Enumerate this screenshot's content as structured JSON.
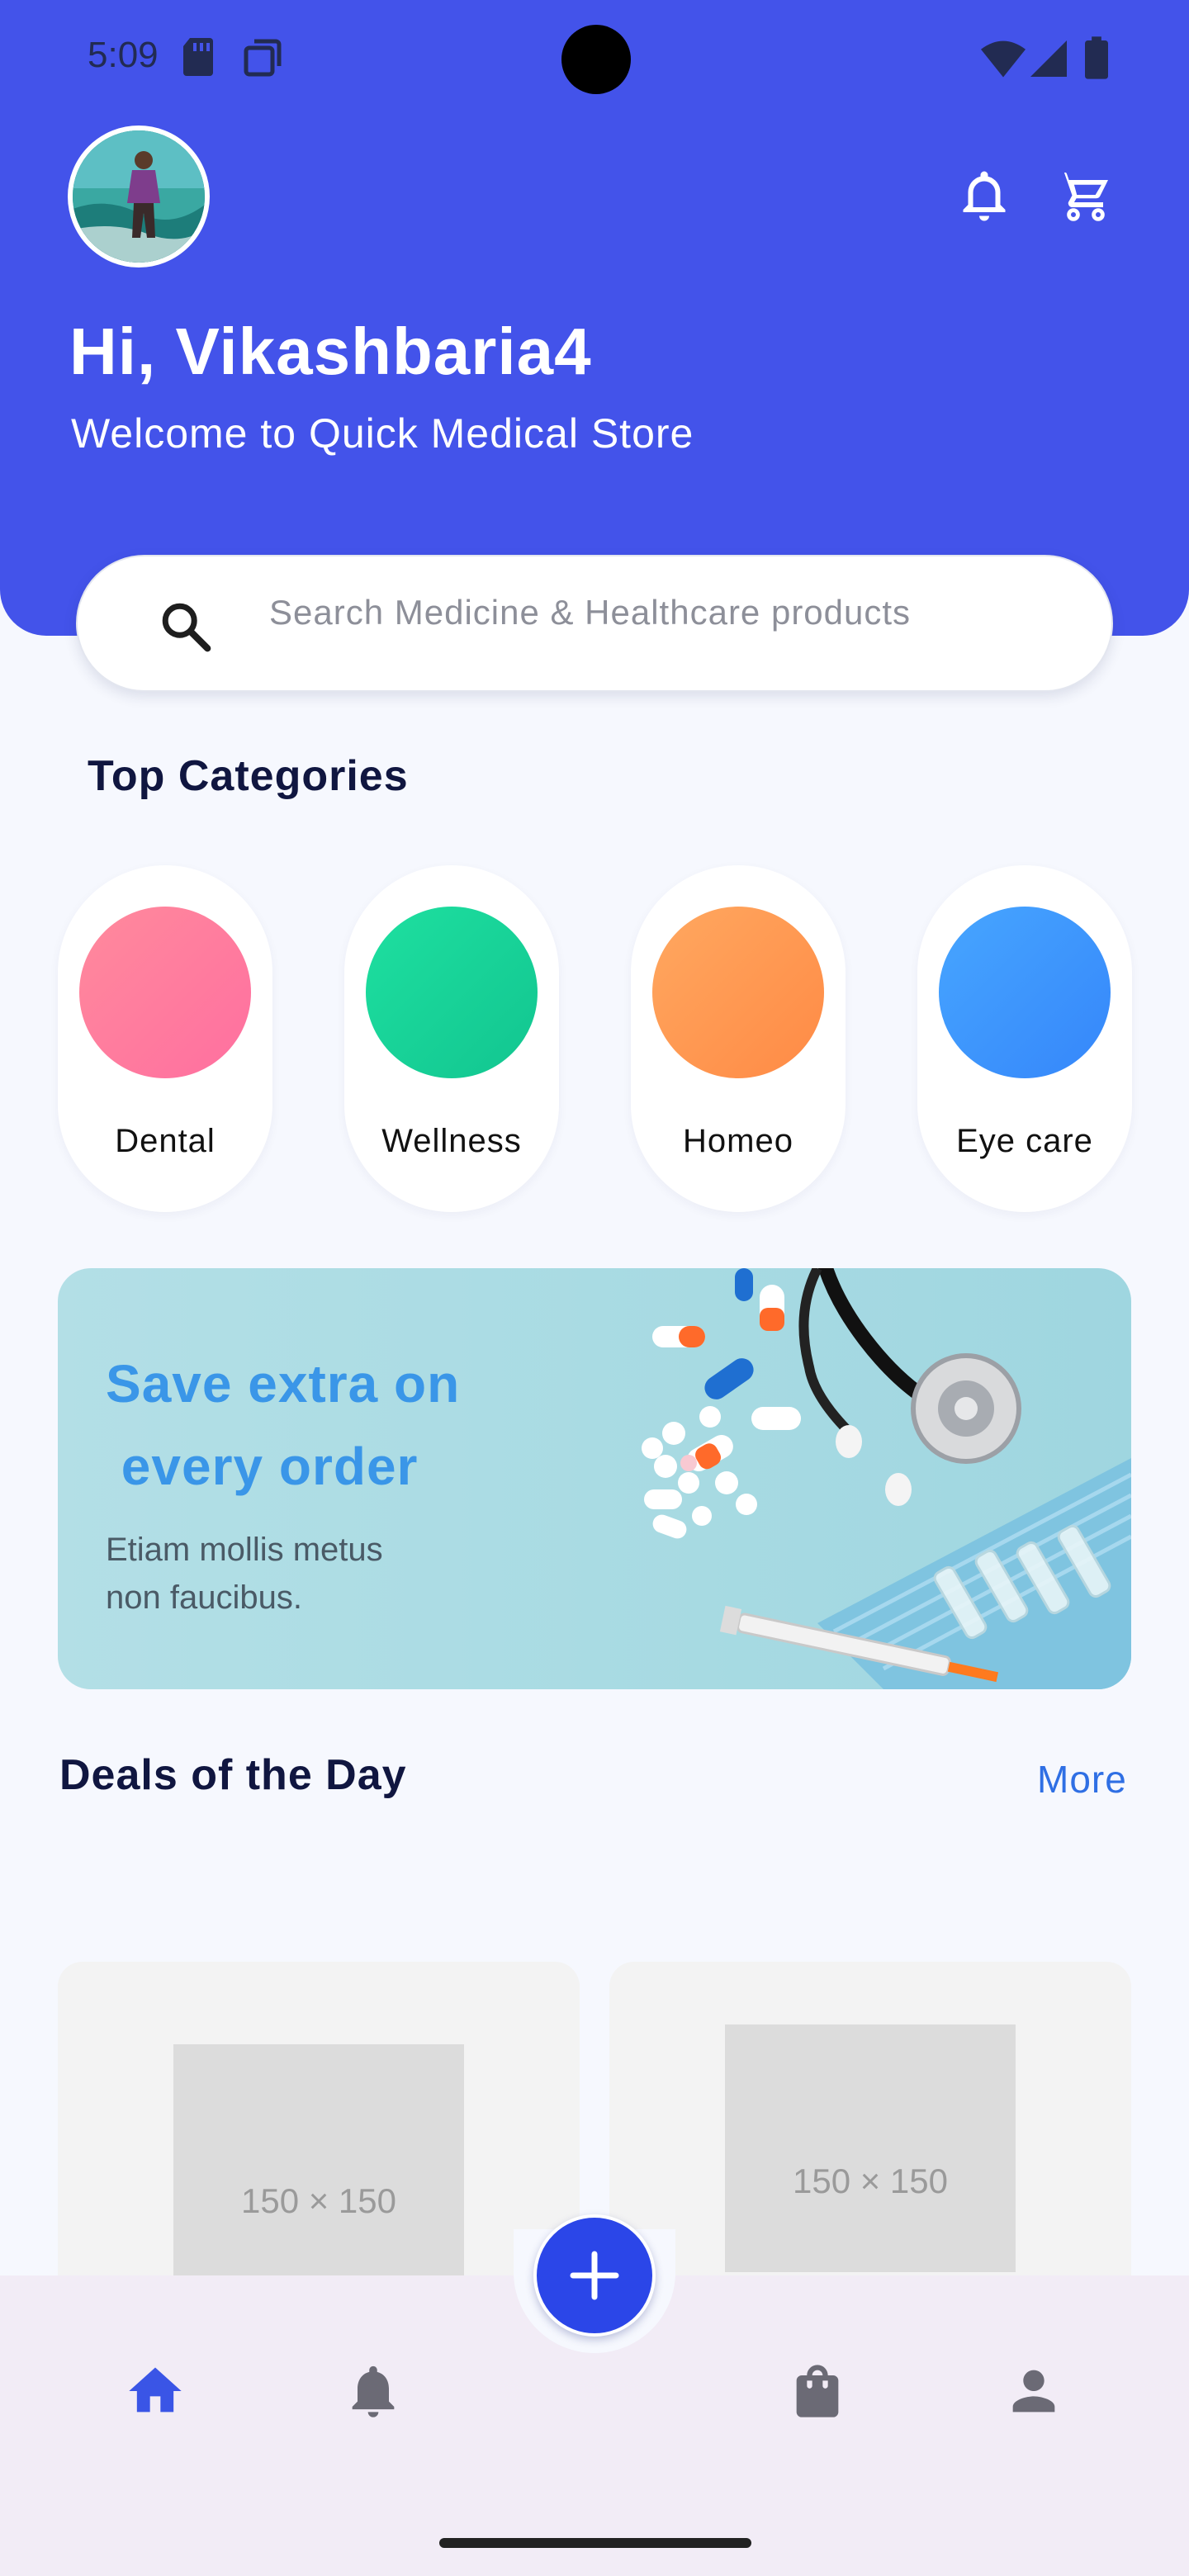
{
  "status_bar": {
    "time": "5:09"
  },
  "header": {
    "greeting": "Hi, Vikashbaria4",
    "welcome": "Welcome to Quick Medical Store"
  },
  "search": {
    "placeholder": "Search Medicine & Healthcare products"
  },
  "top_categories": {
    "title": "Top Categories",
    "items": [
      {
        "label": "Dental",
        "color": "#ff7d9d"
      },
      {
        "label": "Wellness",
        "color": "#1ed79a"
      },
      {
        "label": "Homeo",
        "color": "#ff9650"
      },
      {
        "label": "Eye care",
        "color": "#3d95ff"
      }
    ]
  },
  "banner": {
    "title_line1": "Save extra on",
    "title_line2": " every order",
    "subtitle_line1": "Etiam mollis metus",
    "subtitle_line2": "non faucibus."
  },
  "deals": {
    "title": "Deals of the Day",
    "more_label": "More",
    "cards": [
      {
        "placeholder": "150 × 150"
      },
      {
        "placeholder": "150 × 150"
      }
    ]
  },
  "colors": {
    "primary": "#4353ea",
    "fab": "#2b46e8",
    "active_nav": "#3a55e6",
    "inactive_nav": "#6b6a75"
  },
  "bottom_nav": {
    "items": [
      "home-icon",
      "bell-icon",
      "shopping-bag-icon",
      "person-icon"
    ],
    "fab_icon": "plus-icon"
  }
}
